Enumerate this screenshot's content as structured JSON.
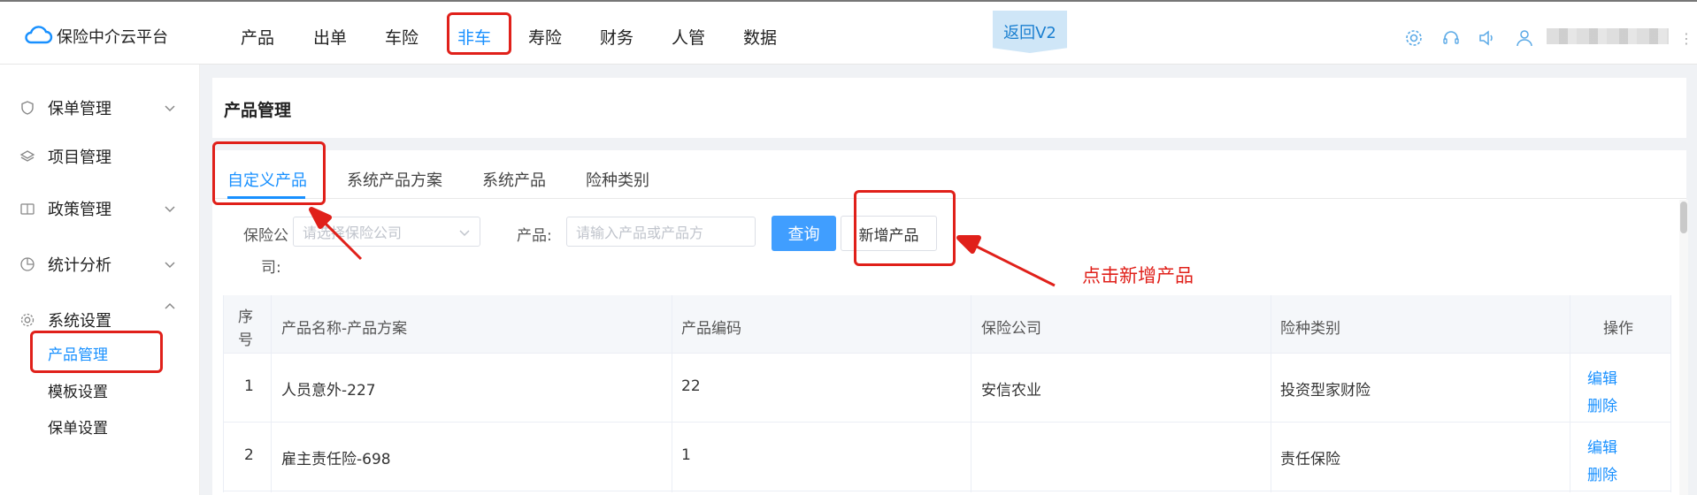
{
  "app": {
    "name": "保险中介云平台"
  },
  "top_nav": {
    "items": [
      "产品",
      "出单",
      "车险",
      "非车",
      "寿险",
      "财务",
      "人管",
      "数据"
    ],
    "active_index": 3,
    "back_label": "返回V2"
  },
  "header_icons": [
    "gear-icon",
    "headset-icon",
    "speaker-icon",
    "user-icon"
  ],
  "sidebar": {
    "items": [
      {
        "label": "保单管理",
        "icon": "shield-icon"
      },
      {
        "label": "项目管理",
        "icon": "layers-icon"
      },
      {
        "label": "政策管理",
        "icon": "book-icon"
      },
      {
        "label": "统计分析",
        "icon": "pie-chart-icon"
      },
      {
        "label": "系统设置",
        "icon": "gear-icon"
      }
    ],
    "sub_items": [
      "产品管理",
      "模板设置",
      "保单设置"
    ],
    "active_sub_index": 0
  },
  "page": {
    "title": "产品管理"
  },
  "tabs": [
    "自定义产品",
    "系统产品方案",
    "系统产品",
    "险种类别"
  ],
  "active_tab": 0,
  "filters": {
    "company_label_line1": "保险公",
    "company_label_line2": "司:",
    "company_placeholder": "请选择保险公司",
    "product_label": "产品:",
    "product_placeholder": "请输入产品或产品方",
    "query_button": "查询",
    "add_button": "新增产品"
  },
  "annotation": "点击新增产品",
  "table": {
    "headers": {
      "index_line1": "序",
      "index_line2": "号",
      "name": "产品名称-产品方案",
      "code": "产品编码",
      "company": "保险公司",
      "category": "险种类别",
      "ops": "操作"
    },
    "rows": [
      {
        "index": "1",
        "name": "人员意外-227",
        "code": "22",
        "company": "安信农业",
        "category": "投资型家财险",
        "edit": "编辑",
        "delete": "删除"
      },
      {
        "index": "2",
        "name": "雇主责任险-698",
        "code": "1",
        "company": "",
        "category": "责任保险",
        "edit": "编辑",
        "delete": "删除"
      }
    ]
  },
  "colors": {
    "accent": "#1890ff",
    "highlight": "#e0201a",
    "primary_button": "#409eff"
  }
}
